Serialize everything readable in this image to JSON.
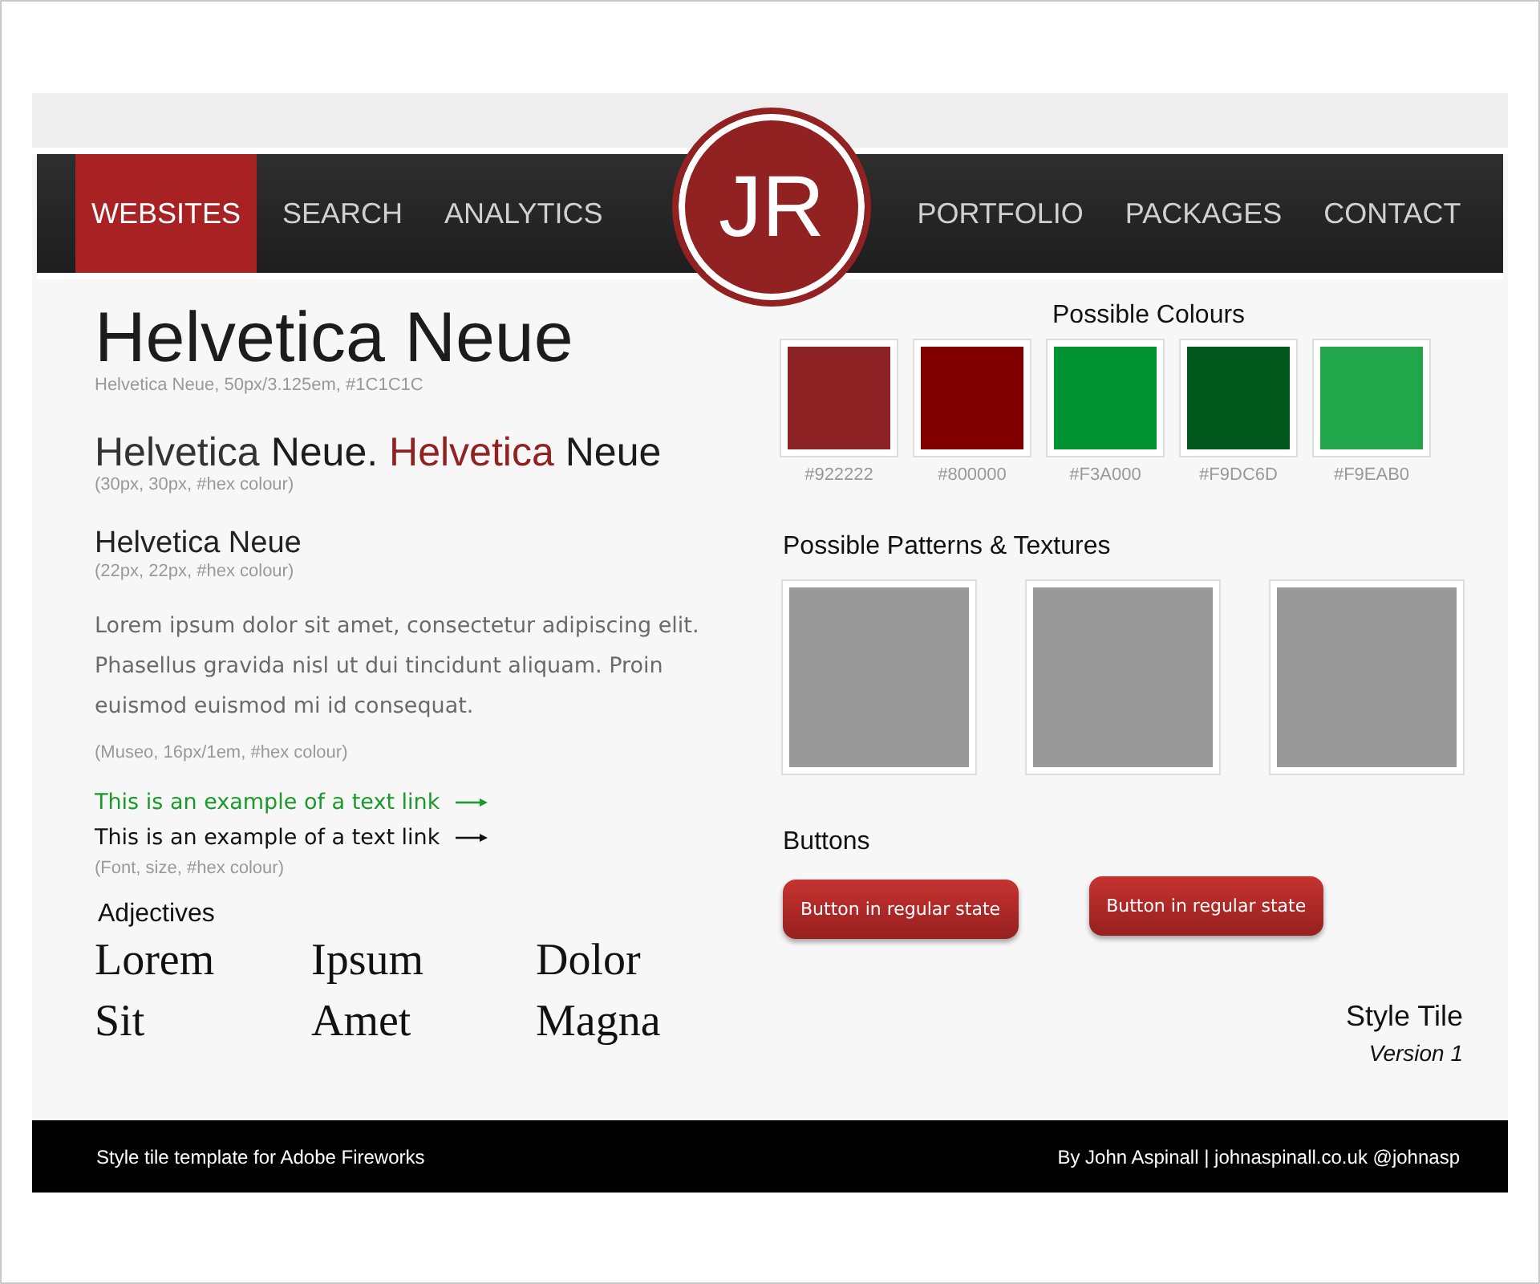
{
  "nav": {
    "left": [
      {
        "label": "WEBSITES",
        "selected": true
      },
      {
        "label": "SEARCH",
        "selected": false
      },
      {
        "label": "ANALYTICS",
        "selected": false
      }
    ],
    "logo": "JR",
    "right": [
      {
        "label": "PORTFOLIO",
        "selected": false
      },
      {
        "label": "PACKAGES",
        "selected": false
      },
      {
        "label": "CONTACT",
        "selected": false
      }
    ]
  },
  "type": {
    "h1": "Helvetica Neue",
    "h1_note": "Helvetica Neue, 50px/3.125em, #1C1C1C",
    "h2_parts": [
      {
        "text": "Helvetica",
        "color": "#333333"
      },
      {
        "text": "Neue.",
        "color": "#1c1c1c"
      },
      {
        "text": "Helvetica",
        "color": "#922222"
      },
      {
        "text": "Neue",
        "color": "#1c1c1c"
      }
    ],
    "h2_note": "(30px, 30px, #hex colour)",
    "h3": "Helvetica Neue",
    "h3_note": "(22px, 22px, #hex colour)",
    "body": "Lorem ipsum dolor sit amet, consectetur adipiscing elit. Phasellus gravida nisl ut dui tincidunt aliquam. Proin euismod euismod mi id consequat.",
    "body_note": "(Museo, 16px/1em, #hex colour)",
    "links": [
      {
        "text": "This is an example of a text link",
        "color": "#1a9a2a"
      },
      {
        "text": "This is an example of a text link",
        "color": "#111111"
      }
    ],
    "links_note": "(Font, size, #hex colour)"
  },
  "adjectives": {
    "title": "Adjectives",
    "words": [
      "Lorem",
      "Ipsum",
      "Dolor",
      "Sit",
      "Amet",
      "Magna"
    ]
  },
  "colours": {
    "title": "Possible Colours",
    "swatches": [
      {
        "label": "#922222",
        "color": "#8e2325"
      },
      {
        "label": "#800000",
        "color": "#800000"
      },
      {
        "label": "#F3A000",
        "color": "#009432"
      },
      {
        "label": "#F9DC6D",
        "color": "#00581c"
      },
      {
        "label": "#F9EAB0",
        "color": "#22a64b"
      }
    ]
  },
  "patterns": {
    "title": "Possible Patterns & Textures",
    "items": [
      {
        "kind": "placeholder"
      },
      {
        "kind": "placeholder"
      },
      {
        "kind": "placeholder"
      }
    ]
  },
  "buttons": {
    "title": "Buttons",
    "items": [
      "Button in regular state",
      "Button in regular state"
    ]
  },
  "tile": {
    "title": "Style Tile",
    "version": "Version 1"
  },
  "footer": {
    "left": "Style tile template for Adobe Fireworks",
    "right": "By John Aspinall | johnaspinall.co.uk @johnasp"
  }
}
